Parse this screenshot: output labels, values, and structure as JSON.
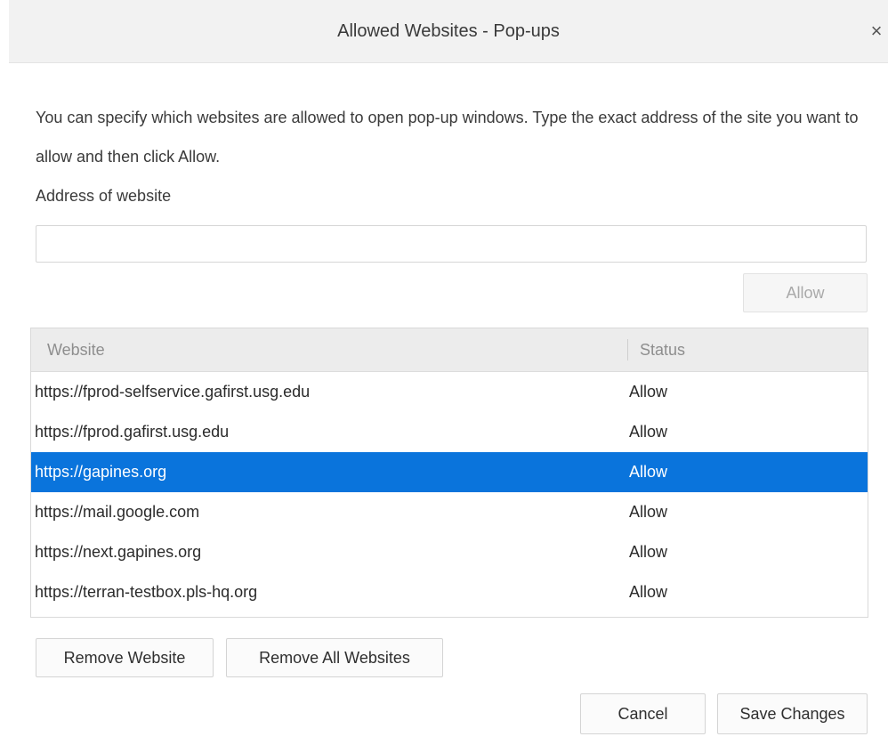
{
  "dialog": {
    "title": "Allowed Websites - Pop-ups",
    "close_glyph": "×"
  },
  "description": "You can specify which websites are allowed to open pop-up windows. Type the exact address of the site you want to allow and then click Allow.",
  "address": {
    "label": "Address of website",
    "value": "",
    "placeholder": ""
  },
  "buttons": {
    "allow": "Allow",
    "remove_website": "Remove Website",
    "remove_all": "Remove All Websites",
    "cancel": "Cancel",
    "save": "Save Changes"
  },
  "table": {
    "columns": [
      "Website",
      "Status"
    ],
    "selected_index": 2,
    "rows": [
      {
        "site": "https://fprod-selfservice.gafirst.usg.edu",
        "status": "Allow"
      },
      {
        "site": "https://fprod.gafirst.usg.edu",
        "status": "Allow"
      },
      {
        "site": "https://gapines.org",
        "status": "Allow"
      },
      {
        "site": "https://mail.google.com",
        "status": "Allow"
      },
      {
        "site": "https://next.gapines.org",
        "status": "Allow"
      },
      {
        "site": "https://terran-testbox.pls-hq.org",
        "status": "Allow"
      }
    ]
  },
  "colors": {
    "selection": "#0a74dc",
    "titlebar": "#f2f2f2"
  }
}
